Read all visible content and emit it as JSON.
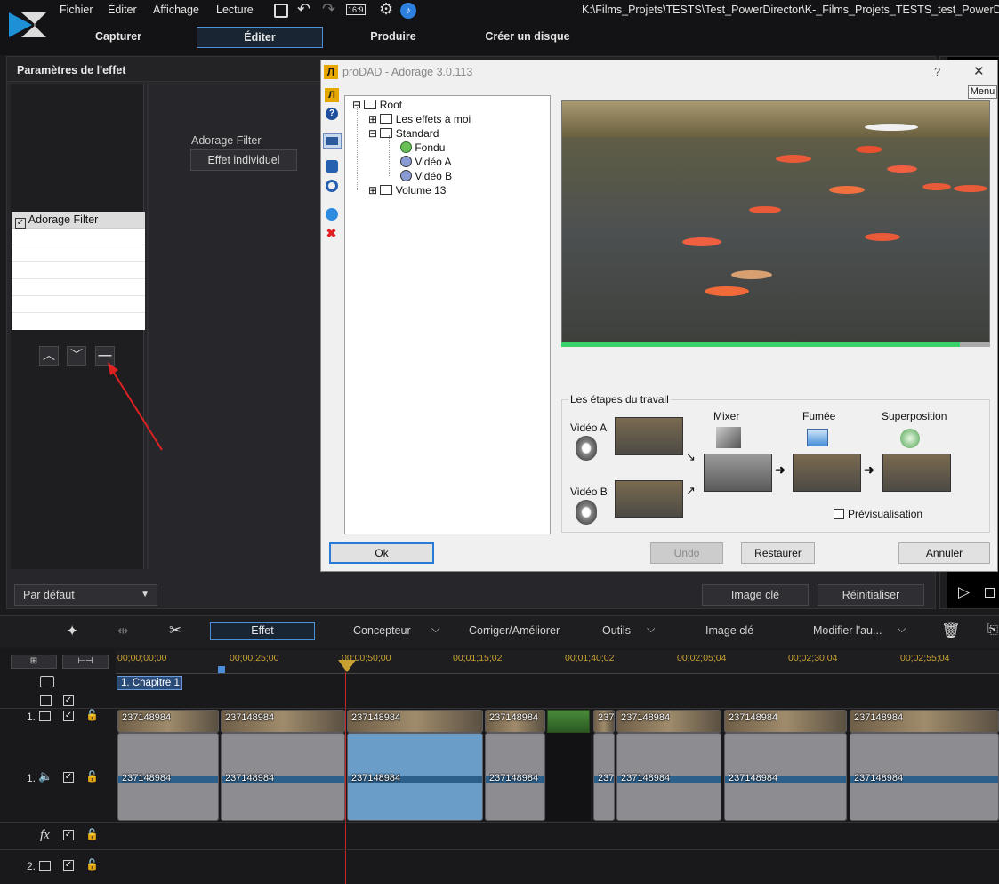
{
  "app": {
    "path": "K:\\Films_Projets\\TESTS\\Test_PowerDirector\\K-_Films_Projets_TESTS_test_PowerDirector_T",
    "menu": [
      "Fichier",
      "Éditer",
      "Affichage",
      "Lecture"
    ],
    "aspect": "16:9",
    "tabs": [
      "Capturer",
      "Éditer",
      "Produire",
      "Créer un disque"
    ]
  },
  "effect_panel": {
    "title": "Paramètres de l'effet",
    "filter_label": "Adorage Filter",
    "individual_button": "Effet individuel",
    "list_item": "Adorage Filter",
    "preset": "Par défaut",
    "keyframe_button": "Image clé",
    "reset_button": "Réinitialiser"
  },
  "dialog": {
    "title": "proDAD - Adorage 3.0.113",
    "help": "?",
    "close": "✕",
    "menu": "Menu",
    "tree": {
      "root": "Root",
      "mine": "Les effets à moi",
      "standard": "Standard",
      "fondu": "Fondu",
      "videoA": "Vidéo A",
      "videoB": "Vidéo B",
      "volume": "Volume 13"
    },
    "workflow": {
      "title": "Les étapes du travail",
      "videoA": "Vidéo A",
      "videoB": "Vidéo B",
      "mixer": "Mixer",
      "fumee": "Fumée",
      "superposition": "Superposition",
      "preview": "Prévisualisation"
    },
    "ok": "Ok",
    "undo": "Undo",
    "restore": "Restaurer",
    "cancel": "Annuler",
    "preview_progress": 0.93
  },
  "toolbar": {
    "effet": "Effet",
    "concepteur": "Concepteur",
    "corriger": "Corriger/Améliorer",
    "outils": "Outils",
    "image_cle": "Image clé",
    "modifier": "Modifier l'au..."
  },
  "timeline": {
    "ruler": [
      "00;00;00;00",
      "00;00;25;00",
      "00;00;50;00",
      "00;01;15;02",
      "00;01;40;02",
      "00;02;05;04",
      "00;02;30;04",
      "00;02;55;04"
    ],
    "chapter": "1. Chapitre 1",
    "clip": "237148984",
    "clip_short": "237",
    "track1": "1.",
    "track2": "2.",
    "fx": "fx"
  },
  "colors": {
    "accent": "#4a8fd8",
    "selected_clip": "#6a9ec9",
    "playhead": "#c62828"
  }
}
